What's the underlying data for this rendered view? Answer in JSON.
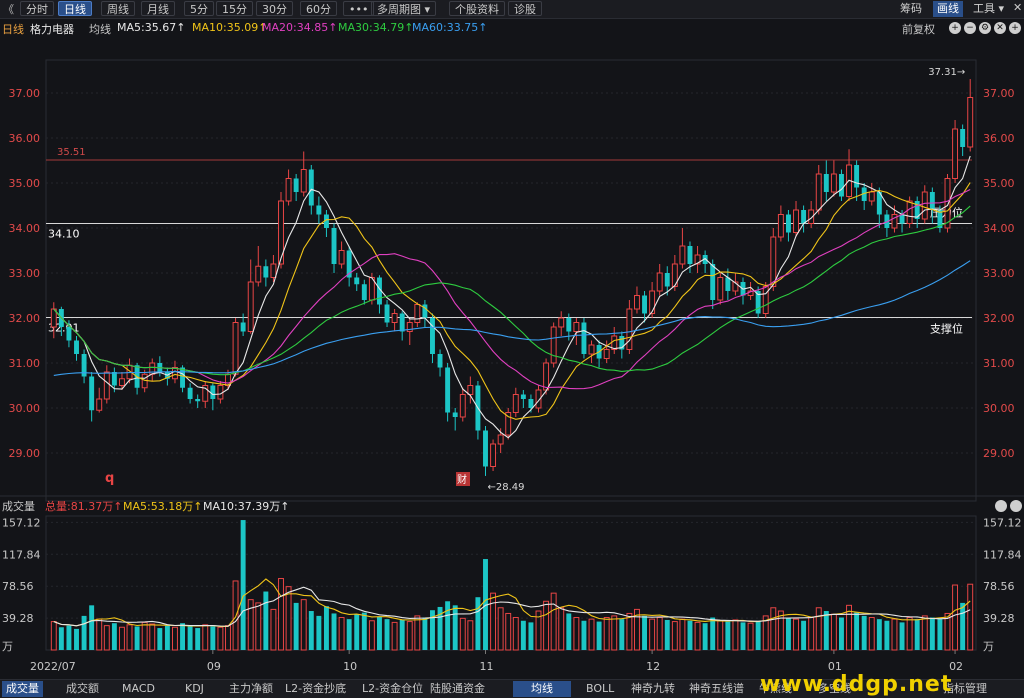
{
  "toolbar": {
    "back_glyph": "《",
    "buttons": [
      "分时",
      "日线",
      "周线",
      "月线",
      "5分",
      "15分",
      "30分",
      "60分",
      "•••",
      "多周期图 ▾",
      "个股资料",
      "诊股"
    ],
    "active": "日线",
    "right_items": [
      "筹码",
      "画线",
      "工具 ▾"
    ],
    "right_active": "画线"
  },
  "info": {
    "period": "日线",
    "stock": "格力电器",
    "indicator": "均线",
    "ma": [
      {
        "label": "MA5:35.67",
        "color": "#e8e8e8"
      },
      {
        "label": "MA10:35.09",
        "color": "#f0c419"
      },
      {
        "label": "MA20:34.85",
        "color": "#e040c0"
      },
      {
        "label": "MA30:34.79",
        "color": "#2ecc40"
      },
      {
        "label": "MA60:33.75",
        "color": "#3a9ff0"
      }
    ],
    "right_text": "前复权"
  },
  "price_chart": {
    "y_ticks": [
      "37.00",
      "36.00",
      "35.00",
      "34.00",
      "33.00",
      "32.00",
      "31.00",
      "30.00",
      "29.00"
    ],
    "resistance_value": "35.51",
    "level_high_label": "34.10",
    "level_low_label": "32.01",
    "resistance_text": "压力位",
    "support_text": "支撑位",
    "max_label": "37.31→",
    "min_label": "←28.49",
    "marker_q": "q",
    "marker_cai": "财"
  },
  "volume_chart": {
    "title": "成交量",
    "total": "总量:81.37万",
    "ma5": "MA5:53.18万",
    "ma10": "MA10:37.39万",
    "y_ticks": [
      "157.12",
      "117.84",
      "78.56",
      "39.28",
      "万"
    ],
    "x_labels": [
      "2022/07",
      "09",
      "10",
      "11",
      "12",
      "01",
      "02"
    ]
  },
  "tabs": {
    "left": [
      "成交量",
      "成交额",
      "MACD",
      "KDJ",
      "主力净额",
      "L2-资金抄底",
      "L2-资金仓位",
      "陆股通资金"
    ],
    "right": [
      "均线",
      "BOLL",
      "神奇九转",
      "神奇五线谱",
      "牛熊线",
      "多空线",
      "指标管理"
    ],
    "active_left": "成交量",
    "active_right": "均线",
    "watermark": "www.ddgp.net"
  },
  "colors": {
    "up": "#e84545",
    "down": "#1cc6c6",
    "bg": "#131418",
    "grid": "#2a2c33"
  },
  "chart_data": {
    "type": "candlestick",
    "ylim": [
      28.2,
      37.6
    ],
    "resistance": 35.51,
    "level_high": 34.1,
    "level_low": 32.01,
    "candles": [
      [
        31.8,
        32.2,
        32.35,
        31.55
      ],
      [
        32.2,
        31.8,
        32.25,
        31.6
      ],
      [
        31.8,
        31.5,
        31.95,
        31.35
      ],
      [
        31.5,
        31.2,
        31.6,
        31.05
      ],
      [
        31.2,
        30.7,
        31.3,
        30.55
      ],
      [
        30.7,
        29.95,
        30.8,
        29.7
      ],
      [
        29.95,
        30.2,
        30.45,
        29.9
      ],
      [
        30.2,
        30.8,
        30.95,
        30.1
      ],
      [
        30.8,
        30.5,
        30.9,
        30.35
      ],
      [
        30.5,
        30.65,
        30.8,
        30.4
      ],
      [
        30.65,
        30.95,
        31.1,
        30.55
      ],
      [
        30.95,
        30.45,
        31.0,
        30.3
      ],
      [
        30.45,
        30.75,
        30.85,
        30.35
      ],
      [
        30.75,
        31.0,
        31.1,
        30.6
      ],
      [
        31.0,
        30.8,
        31.15,
        30.7
      ],
      [
        30.8,
        30.65,
        30.9,
        30.5
      ],
      [
        30.65,
        30.9,
        31.05,
        30.55
      ],
      [
        30.9,
        30.45,
        30.95,
        30.35
      ],
      [
        30.45,
        30.2,
        30.55,
        30.1
      ],
      [
        30.2,
        30.15,
        30.3,
        30.0
      ],
      [
        30.15,
        30.5,
        30.6,
        30.0
      ],
      [
        30.5,
        30.2,
        30.55,
        29.95
      ],
      [
        30.2,
        30.5,
        30.6,
        30.1
      ],
      [
        30.5,
        30.75,
        30.85,
        30.4
      ],
      [
        30.75,
        31.9,
        32.0,
        30.7
      ],
      [
        31.9,
        31.7,
        32.1,
        31.6
      ],
      [
        31.7,
        32.8,
        33.3,
        31.65
      ],
      [
        32.8,
        33.15,
        33.6,
        32.7
      ],
      [
        33.15,
        32.9,
        33.3,
        32.7
      ],
      [
        32.9,
        33.2,
        33.4,
        32.8
      ],
      [
        33.2,
        34.6,
        34.8,
        33.1
      ],
      [
        34.6,
        35.1,
        35.3,
        34.5
      ],
      [
        35.1,
        34.8,
        35.2,
        34.6
      ],
      [
        34.8,
        35.3,
        35.7,
        34.7
      ],
      [
        35.3,
        34.5,
        35.4,
        34.3
      ],
      [
        34.5,
        34.3,
        34.7,
        34.1
      ],
      [
        34.3,
        34.0,
        34.4,
        33.8
      ],
      [
        34.0,
        33.2,
        34.1,
        33.0
      ],
      [
        33.2,
        33.5,
        33.7,
        33.1
      ],
      [
        33.5,
        32.9,
        33.6,
        32.7
      ],
      [
        32.9,
        32.75,
        33.0,
        32.6
      ],
      [
        32.75,
        32.4,
        32.85,
        32.3
      ],
      [
        32.4,
        32.9,
        33.0,
        32.3
      ],
      [
        32.9,
        32.3,
        32.95,
        32.1
      ],
      [
        32.3,
        31.9,
        32.4,
        31.8
      ],
      [
        31.9,
        32.1,
        32.2,
        31.7
      ],
      [
        32.1,
        31.7,
        32.15,
        31.5
      ],
      [
        31.7,
        31.9,
        32.0,
        31.4
      ],
      [
        31.9,
        32.3,
        32.35,
        31.8
      ],
      [
        32.3,
        32.0,
        32.4,
        31.8
      ],
      [
        32.0,
        31.2,
        32.1,
        31.0
      ],
      [
        31.2,
        30.9,
        31.3,
        30.7
      ],
      [
        30.9,
        29.9,
        31.0,
        29.7
      ],
      [
        29.9,
        29.8,
        30.0,
        29.5
      ],
      [
        29.8,
        30.3,
        30.45,
        29.7
      ],
      [
        30.3,
        30.5,
        30.7,
        30.1
      ],
      [
        30.5,
        29.5,
        30.6,
        29.3
      ],
      [
        29.5,
        28.7,
        29.6,
        28.49
      ],
      [
        28.7,
        29.2,
        29.3,
        28.6
      ],
      [
        29.2,
        29.4,
        29.55,
        29.0
      ],
      [
        29.4,
        29.9,
        30.0,
        29.3
      ],
      [
        29.9,
        30.3,
        30.45,
        29.8
      ],
      [
        30.3,
        30.2,
        30.4,
        30.0
      ],
      [
        30.2,
        30.0,
        30.3,
        29.9
      ],
      [
        30.0,
        30.4,
        30.5,
        29.9
      ],
      [
        30.4,
        31.0,
        31.1,
        30.3
      ],
      [
        31.0,
        31.8,
        31.9,
        30.9
      ],
      [
        31.8,
        32.0,
        32.15,
        31.6
      ],
      [
        32.0,
        31.7,
        32.1,
        31.5
      ],
      [
        31.7,
        31.9,
        32.0,
        31.4
      ],
      [
        31.9,
        31.2,
        32.0,
        31.1
      ],
      [
        31.2,
        31.4,
        31.5,
        31.0
      ],
      [
        31.4,
        31.1,
        31.5,
        30.9
      ],
      [
        31.1,
        31.3,
        31.5,
        31.0
      ],
      [
        31.3,
        31.6,
        31.8,
        31.2
      ],
      [
        31.6,
        31.3,
        31.7,
        31.1
      ],
      [
        31.3,
        32.2,
        32.4,
        31.2
      ],
      [
        32.2,
        32.5,
        32.7,
        32.1
      ],
      [
        32.5,
        32.1,
        32.6,
        31.9
      ],
      [
        32.1,
        32.6,
        32.8,
        32.0
      ],
      [
        32.6,
        33.0,
        33.2,
        32.5
      ],
      [
        33.0,
        32.7,
        33.15,
        32.5
      ],
      [
        32.7,
        33.2,
        33.4,
        32.6
      ],
      [
        33.2,
        33.6,
        34.0,
        33.1
      ],
      [
        33.6,
        33.2,
        33.7,
        33.0
      ],
      [
        33.2,
        33.4,
        33.6,
        33.0
      ],
      [
        33.4,
        33.2,
        33.5,
        33.0
      ],
      [
        33.2,
        32.4,
        33.3,
        32.2
      ],
      [
        32.4,
        32.9,
        33.0,
        32.3
      ],
      [
        32.9,
        32.6,
        33.1,
        32.4
      ],
      [
        32.6,
        32.8,
        33.0,
        32.5
      ],
      [
        32.8,
        32.5,
        32.9,
        32.3
      ],
      [
        32.5,
        32.6,
        32.8,
        32.4
      ],
      [
        32.6,
        32.1,
        32.7,
        32.0
      ],
      [
        32.1,
        32.7,
        32.8,
        32.0
      ],
      [
        32.7,
        33.8,
        34.0,
        32.6
      ],
      [
        33.8,
        34.3,
        34.5,
        33.7
      ],
      [
        34.3,
        33.9,
        34.4,
        33.7
      ],
      [
        33.9,
        34.4,
        34.6,
        33.8
      ],
      [
        34.4,
        34.1,
        34.5,
        33.9
      ],
      [
        34.1,
        34.4,
        34.6,
        34.0
      ],
      [
        34.4,
        35.2,
        35.4,
        34.3
      ],
      [
        35.2,
        34.8,
        35.5,
        34.6
      ],
      [
        34.8,
        35.2,
        35.5,
        34.7
      ],
      [
        35.2,
        34.7,
        35.3,
        34.6
      ],
      [
        34.7,
        35.4,
        35.75,
        34.6
      ],
      [
        35.4,
        34.9,
        35.5,
        34.6
      ],
      [
        34.9,
        34.6,
        35.0,
        34.4
      ],
      [
        34.6,
        34.8,
        35.0,
        34.5
      ],
      [
        34.8,
        34.3,
        34.9,
        34.0
      ],
      [
        34.3,
        34.0,
        34.4,
        33.8
      ],
      [
        34.0,
        34.3,
        34.5,
        33.9
      ],
      [
        34.3,
        34.1,
        34.4,
        33.9
      ],
      [
        34.1,
        34.6,
        34.7,
        34.0
      ],
      [
        34.6,
        34.2,
        34.7,
        34.0
      ],
      [
        34.2,
        34.8,
        34.95,
        34.1
      ],
      [
        34.8,
        34.4,
        34.9,
        34.1
      ],
      [
        34.4,
        34.0,
        34.5,
        33.9
      ],
      [
        34.0,
        35.1,
        35.2,
        33.9
      ],
      [
        35.1,
        36.2,
        36.4,
        35.0
      ],
      [
        36.2,
        35.8,
        36.3,
        35.6
      ],
      [
        35.8,
        36.9,
        37.31,
        35.7
      ]
    ],
    "volume": [
      35,
      28,
      30,
      26,
      42,
      55,
      38,
      30,
      33,
      28,
      31,
      29,
      34,
      32,
      27,
      30,
      28,
      33,
      30,
      27,
      31,
      29,
      28,
      30,
      85,
      160,
      62,
      58,
      72,
      50,
      88,
      78,
      58,
      62,
      48,
      42,
      54,
      45,
      40,
      38,
      44,
      46,
      36,
      41,
      38,
      34,
      37,
      35,
      42,
      40,
      49,
      53,
      60,
      55,
      39,
      36,
      65,
      112,
      70,
      52,
      45,
      40,
      36,
      34,
      48,
      60,
      70,
      52,
      45,
      40,
      36,
      38,
      35,
      40,
      42,
      38,
      45,
      50,
      42,
      38,
      40,
      37,
      35,
      38,
      36,
      34,
      33,
      40,
      36,
      35,
      37,
      34,
      33,
      36,
      42,
      52,
      48,
      40,
      38,
      36,
      40,
      52,
      48,
      44,
      40,
      55,
      46,
      42,
      40,
      38,
      36,
      38,
      34,
      40,
      38,
      42,
      40,
      38,
      45,
      80,
      58,
      81
    ]
  }
}
